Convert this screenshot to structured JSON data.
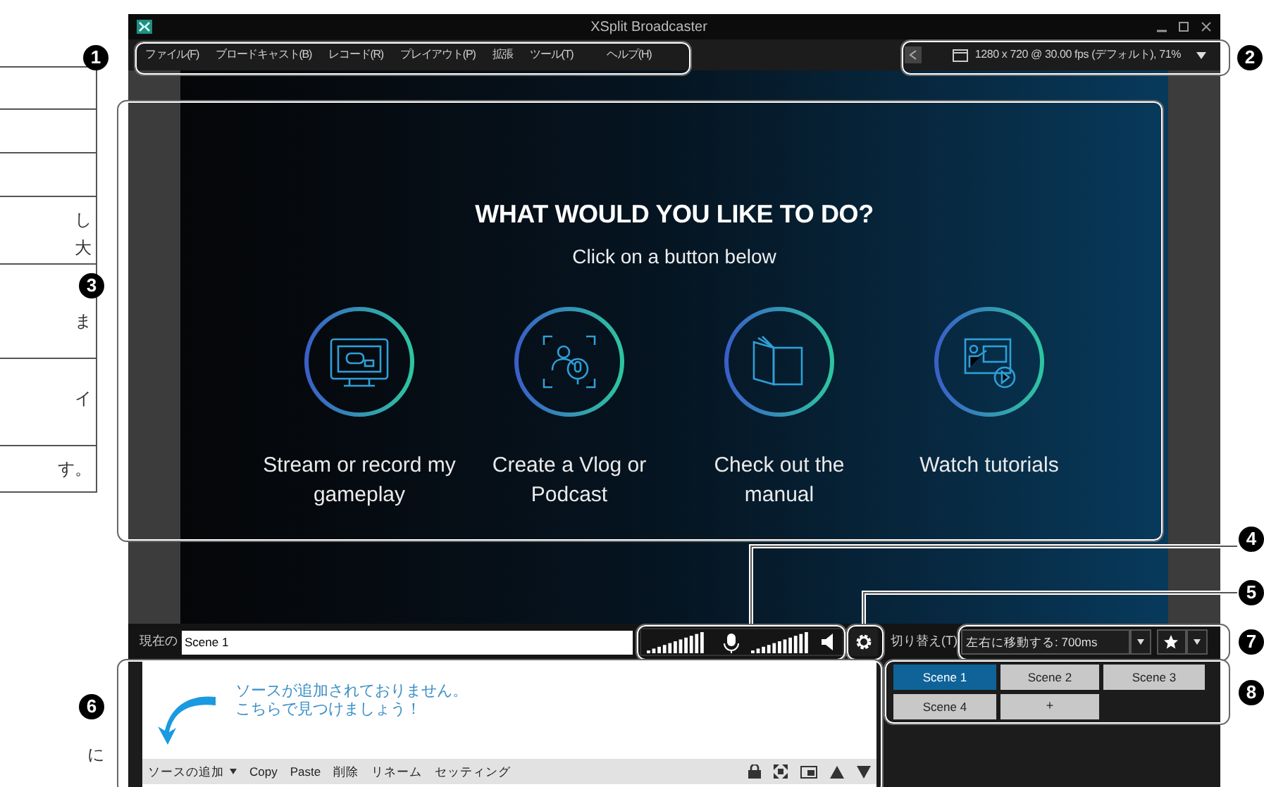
{
  "side_table": {
    "rows": [
      {
        "lines": [
          "し",
          "大"
        ]
      },
      {
        "lines": [
          "ま"
        ]
      },
      {
        "lines": [
          "イ"
        ]
      },
      {
        "lines": [
          "す。"
        ]
      }
    ]
  },
  "side_note": "に",
  "callouts": [
    {
      "number": "1"
    },
    {
      "number": "2"
    },
    {
      "number": "3"
    },
    {
      "number": "4"
    },
    {
      "number": "5"
    },
    {
      "number": "7"
    },
    {
      "number": "8"
    },
    {
      "number": "6"
    }
  ],
  "window": {
    "title": "XSplit Broadcaster"
  },
  "menu": [
    "ファイル(F)",
    "ブロードキャスト(B)",
    "レコード(R)",
    "プレイアウト(P)",
    "拡張",
    "ツール(T)",
    "ヘルプ(H)"
  ],
  "resolution": "1280 x 720 @ 30.00 fps (デフォルト), 71%",
  "welcome": {
    "heading": "WHAT WOULD YOU LIKE TO DO?",
    "subheading": "Click on a button below",
    "options": [
      {
        "kind": "gameplay",
        "label": "Stream or record my gameplay"
      },
      {
        "kind": "vlog",
        "label": "Create a Vlog or Podcast"
      },
      {
        "kind": "manual",
        "label": "Check out the manual"
      },
      {
        "kind": "tutorials",
        "label": "Watch tutorials"
      }
    ]
  },
  "current_scene": {
    "label": "現在の",
    "value": "Scene 1"
  },
  "transition": {
    "label": "切り替え(T)",
    "value": "左右に移動する: 700ms"
  },
  "sources": {
    "empty_message": [
      "ソースが追加されておりません。",
      "こちらで見つけましょう！"
    ],
    "add_label": "ソースの追加",
    "toolbar": [
      "Copy",
      "Paste",
      "削除",
      "リネーム",
      "セッティング"
    ]
  },
  "scenes": [
    {
      "label": "Scene 1",
      "selected": true
    },
    {
      "label": "Scene 2",
      "selected": false
    },
    {
      "label": "Scene 3",
      "selected": false
    },
    {
      "label": "Scene 4",
      "selected": false
    }
  ],
  "add_scene": "+"
}
